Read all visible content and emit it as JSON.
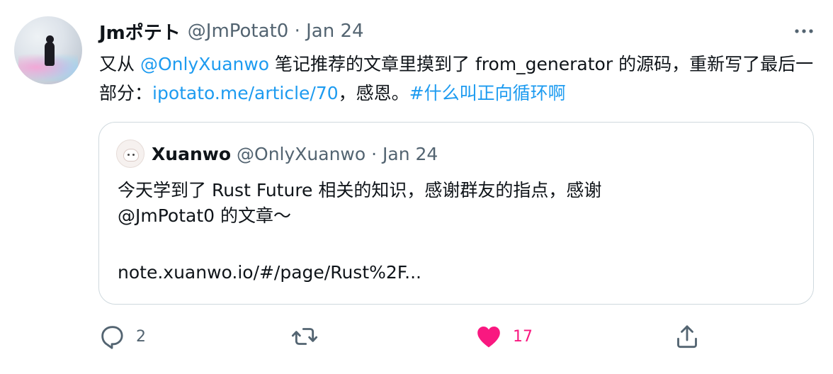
{
  "tweet": {
    "display_name": "Jmポテト",
    "handle": "@JmPotat0",
    "separator": " · ",
    "date": "Jan 24",
    "text_parts": [
      {
        "text": "又从 ",
        "type": "text"
      },
      {
        "text": "@OnlyXuanwo",
        "type": "link"
      },
      {
        "text": " 笔记推荐的文章里摸到了 from_generator 的源码，重新写了最后一部分：",
        "type": "text"
      },
      {
        "text": "ipotato.me/article/70",
        "type": "link"
      },
      {
        "text": "，感恩。",
        "type": "text"
      },
      {
        "text": "#什么叫正向循环啊",
        "type": "link"
      }
    ],
    "more_icon": "more-horizontal-icon"
  },
  "quoted": {
    "display_name": "Xuanwo",
    "handle": "@OnlyXuanwo",
    "separator": " · ",
    "date": "Jan 24",
    "line1": "今天学到了 Rust Future 相关的知识，感谢群友的指点，感谢",
    "line2": "@JmPotat0 的文章～",
    "link": "note.xuanwo.io/#/page/Rust%2F..."
  },
  "actions": {
    "reply": {
      "icon": "reply-icon",
      "count": "2"
    },
    "retweet": {
      "icon": "retweet-icon",
      "count": ""
    },
    "like": {
      "icon": "heart-icon",
      "count": "17",
      "liked": true
    },
    "share": {
      "icon": "share-icon"
    }
  },
  "colors": {
    "link": "#1d9bf0",
    "muted": "#536471",
    "like": "#f91880",
    "border": "#cfd9de",
    "text": "#0f1419"
  }
}
